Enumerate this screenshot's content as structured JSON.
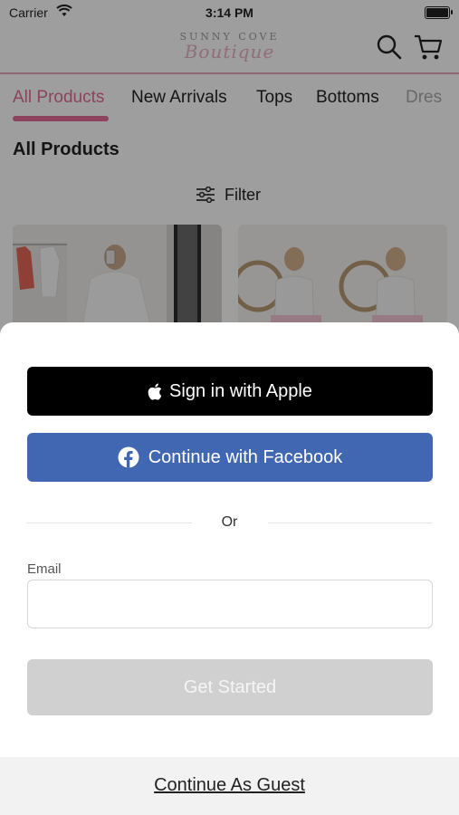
{
  "status_bar": {
    "carrier": "Carrier",
    "time": "3:14 PM"
  },
  "header": {
    "logo_top": "SUNNY COVE",
    "logo_script": "Boutique",
    "icons": [
      "search-icon",
      "cart-icon"
    ]
  },
  "tabs": [
    {
      "label": "All Products",
      "active": true
    },
    {
      "label": "New Arrivals",
      "active": false
    },
    {
      "label": "Tops",
      "active": false
    },
    {
      "label": "Bottoms",
      "active": false
    },
    {
      "label": "Dres",
      "active": false
    }
  ],
  "section": {
    "title": "All Products",
    "filter_label": "Filter"
  },
  "login_sheet": {
    "apple_label": "Sign in with Apple",
    "facebook_label": "Continue with Facebook",
    "or_label": "Or",
    "email_label": "Email",
    "email_value": "",
    "get_started_label": "Get Started",
    "guest_label": "Continue As Guest"
  },
  "colors": {
    "accent": "#e46c97",
    "facebook": "#4267b2",
    "apple": "#000000",
    "disabled_button": "#d0d0d0"
  }
}
